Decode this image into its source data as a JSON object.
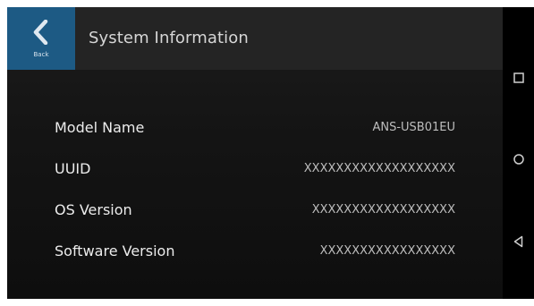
{
  "header": {
    "back_label": "Back",
    "title": "System Information"
  },
  "info": [
    {
      "label": "Model Name",
      "value": "ANS-USB01EU"
    },
    {
      "label": "UUID",
      "value": "XXXXXXXXXXXXXXXXXXX"
    },
    {
      "label": "OS Version",
      "value": "XXXXXXXXXXXXXXXXXX"
    },
    {
      "label": "Software Version",
      "value": "XXXXXXXXXXXXXXXXX"
    }
  ],
  "nav": {
    "recents_icon": "square-icon",
    "home_icon": "circle-icon",
    "back_icon": "triangle-back-icon"
  },
  "colors": {
    "back_button": "#1d5a84",
    "header": "#242424",
    "background": "#141414"
  }
}
